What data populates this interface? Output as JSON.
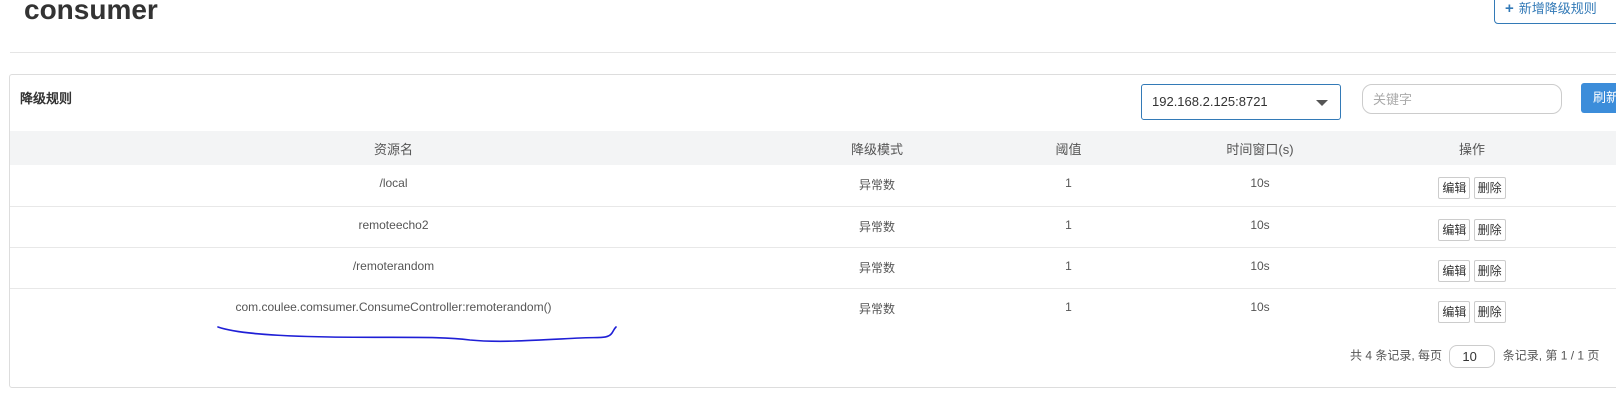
{
  "header": {
    "title": "consumer",
    "add_button_label": "新增降级规则",
    "add_icon": "plus-icon"
  },
  "panel": {
    "title": "降级规则",
    "machine_select": {
      "selected": "192.168.2.125:8721"
    },
    "search": {
      "placeholder": "关键字",
      "value": ""
    },
    "refresh_label": "刷新"
  },
  "table": {
    "columns": [
      "资源名",
      "降级模式",
      "阈值",
      "时间窗口(s)",
      "操作"
    ],
    "rows": [
      {
        "resource": "/local",
        "mode": "异常数",
        "threshold": "1",
        "window": "10s"
      },
      {
        "resource": "remoteecho2",
        "mode": "异常数",
        "threshold": "1",
        "window": "10s"
      },
      {
        "resource": "/remoterandom",
        "mode": "异常数",
        "threshold": "1",
        "window": "10s"
      },
      {
        "resource": "com.coulee.comsumer.ConsumeController:remoterandom()",
        "mode": "异常数",
        "threshold": "1",
        "window": "10s"
      }
    ],
    "edit_label": "编辑",
    "delete_label": "删除"
  },
  "pagination": {
    "prefix": "共 4 条记录, 每页",
    "page_size": "10",
    "suffix": "条记录, 第 1 / 1 页"
  },
  "colors": {
    "accent": "#337ab7",
    "refresh_bg": "#3c8dda",
    "annotation_stroke": "#1f1fd6"
  }
}
